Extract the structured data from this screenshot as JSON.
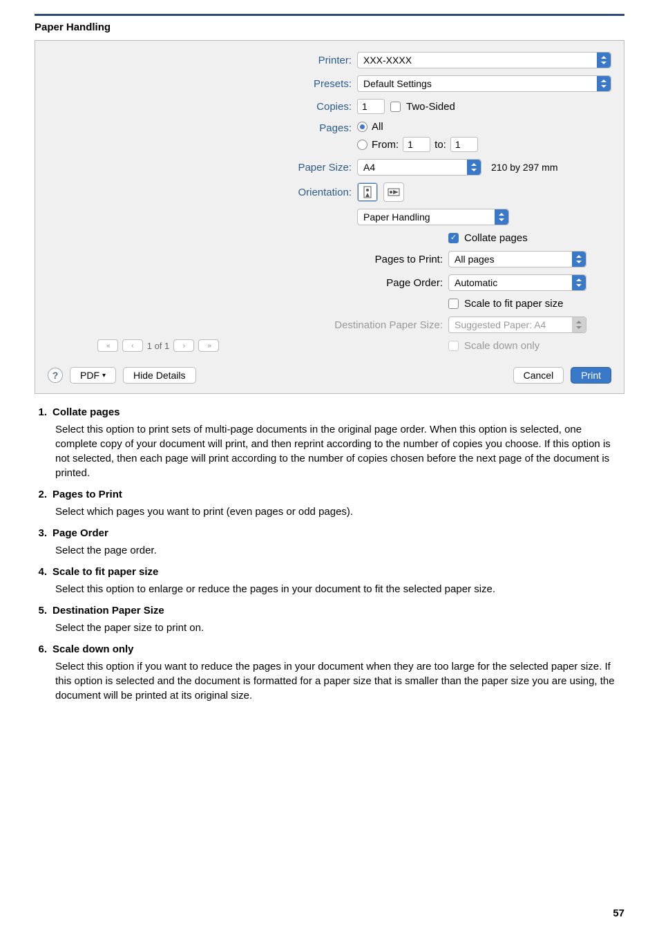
{
  "section_title": "Paper Handling",
  "dialog": {
    "printer_label": "Printer:",
    "printer_value": "XXX-XXXX",
    "presets_label": "Presets:",
    "presets_value": "Default Settings",
    "copies_label": "Copies:",
    "copies_value": "1",
    "two_sided_label": "Two-Sided",
    "pages_label": "Pages:",
    "pages_all": "All",
    "pages_from": "From:",
    "pages_from_value": "1",
    "pages_to": "to:",
    "pages_to_value": "1",
    "paper_size_label": "Paper Size:",
    "paper_size_value": "A4",
    "paper_dims": "210 by 297 mm",
    "orientation_label": "Orientation:",
    "module_label": "Paper Handling",
    "collate_label": "Collate pages",
    "pages_to_print_label": "Pages to Print:",
    "pages_to_print_value": "All pages",
    "page_order_label": "Page Order:",
    "page_order_value": "Automatic",
    "scale_fit_label": "Scale to fit paper size",
    "dest_size_label": "Destination Paper Size:",
    "dest_size_value": "Suggested Paper: A4",
    "scale_down_label": "Scale down only",
    "nav_text": "1 of 1",
    "help_label": "?",
    "pdf_label": "PDF",
    "hide_details_label": "Hide Details",
    "cancel_label": "Cancel",
    "print_label": "Print"
  },
  "descriptions": [
    {
      "num": "1.",
      "title": "Collate pages",
      "body": "Select this option to print sets of multi-page documents in the original page order. When this option is selected, one complete copy of your document will print, and then reprint according to the number of copies you choose. If this option is not selected, then each page will print according to the number of copies chosen before the next page of the document is printed."
    },
    {
      "num": "2.",
      "title": "Pages to Print",
      "body": "Select which pages you want to print (even pages or odd pages)."
    },
    {
      "num": "3.",
      "title": "Page Order",
      "body": "Select the page order."
    },
    {
      "num": "4.",
      "title": "Scale to fit paper size",
      "body": "Select this option to enlarge or reduce the pages in your document to fit the selected paper size."
    },
    {
      "num": "5.",
      "title": "Destination Paper Size",
      "body": "Select the paper size to print on."
    },
    {
      "num": "6.",
      "title": "Scale down only",
      "body": "Select this option if you want to reduce the pages in your document when they are too large for the selected paper size. If this option is selected and the document is formatted for a paper size that is smaller than the paper size you are using, the document will be printed at its original size."
    }
  ],
  "page_number": "57"
}
